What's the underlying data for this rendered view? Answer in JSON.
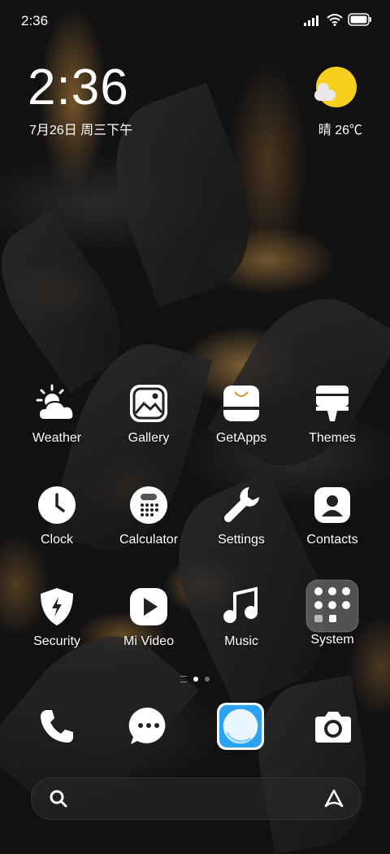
{
  "status_bar": {
    "time": "2:36",
    "icons": [
      "signal-icon",
      "wifi-icon",
      "battery-icon"
    ]
  },
  "lock_widget": {
    "time": "2:36",
    "date": "7月26日 周三下午"
  },
  "weather": {
    "condition": "晴",
    "temperature": "晴 26℃",
    "icon": "sun-cloud-icon"
  },
  "apps": [
    {
      "label": "Weather",
      "icon": "weather-icon"
    },
    {
      "label": "Gallery",
      "icon": "gallery-icon"
    },
    {
      "label": "GetApps",
      "icon": "getapps-icon"
    },
    {
      "label": "Themes",
      "icon": "themes-icon"
    },
    {
      "label": "Clock",
      "icon": "clock-icon"
    },
    {
      "label": "Calculator",
      "icon": "calculator-icon"
    },
    {
      "label": "Settings",
      "icon": "settings-icon"
    },
    {
      "label": "Contacts",
      "icon": "contacts-icon"
    },
    {
      "label": "Security",
      "icon": "security-icon"
    },
    {
      "label": "Mi Video",
      "icon": "mi-video-icon"
    },
    {
      "label": "Music",
      "icon": "music-icon"
    },
    {
      "label": "System",
      "icon": "system-folder-icon"
    }
  ],
  "dock": [
    "phone-icon",
    "messages-icon",
    "browser-icon",
    "camera-icon"
  ],
  "page_indicator": {
    "pages": 2,
    "current": 1
  },
  "colors": {
    "sun": "#f7cf1d",
    "browser_bg": "#2aa3f5",
    "accent_gold": "#d8a253"
  }
}
